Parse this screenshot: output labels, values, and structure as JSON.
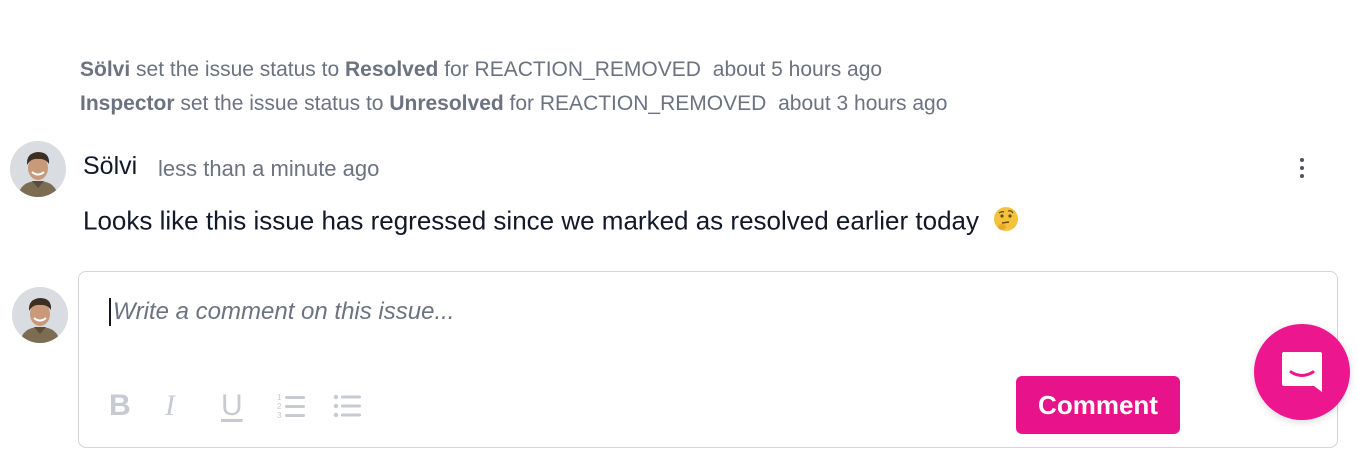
{
  "activity": [
    {
      "actor": "Sölvi",
      "text": "set the issue status to",
      "status": "Resolved",
      "suffix": "for REACTION_REMOVED",
      "time": "about 5 hours ago"
    },
    {
      "actor": "Inspector",
      "text": "set the issue status to",
      "status": "Unresolved",
      "suffix": "for REACTION_REMOVED",
      "time": "about 3 hours ago"
    }
  ],
  "comment": {
    "author": "Sölvi",
    "time": "less than a minute ago",
    "body": "Looks like this issue has regressed since we marked as resolved earlier today",
    "emoji": "thinking-face-icon"
  },
  "composer": {
    "placeholder": "Write a comment on this issue...",
    "value": "",
    "toolbar": [
      "bold-icon",
      "italic-icon",
      "underline-icon",
      "ordered-list-icon",
      "bullet-list-icon"
    ],
    "submit_label": "Comment"
  },
  "colors": {
    "accent": "#e8138b",
    "muted_text": "#6b7280",
    "border": "#d1d5db"
  }
}
